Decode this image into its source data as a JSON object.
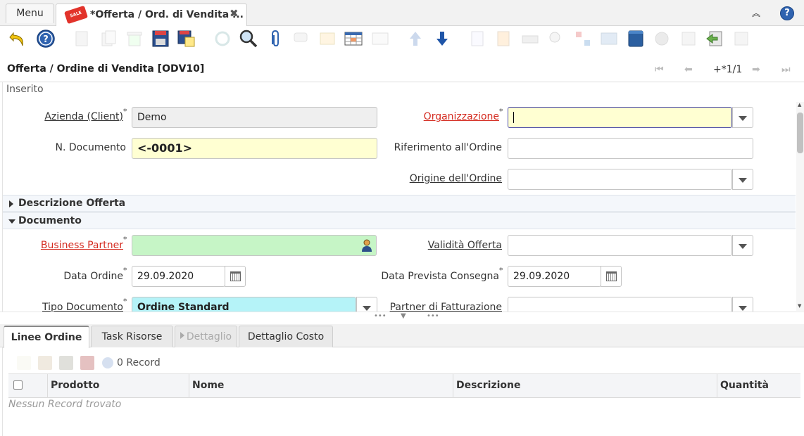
{
  "tabs": {
    "menu_label": "Menu",
    "doc_tab_title": "*Offerta / Ord. di Vendita ...",
    "doc_tab_icon_text": "SALE"
  },
  "window": {
    "title": "Offerta / Ordine di Vendita [ODV10]",
    "record_nav": "+*1/1",
    "status": "Inserito"
  },
  "form": {
    "client_label": "Azienda (Client)",
    "client_value": "Demo",
    "org_label": "Organizzazione",
    "org_value": "",
    "docno_label": "N. Documento",
    "docno_value": "<-0001>",
    "order_ref_label": "Riferimento all'Ordine",
    "order_ref_value": "",
    "order_source_label": "Origine dell'Ordine",
    "order_source_value": "",
    "section_description": "Descrizione Offerta",
    "section_document": "Documento",
    "bp_label": "Business Partner",
    "bp_value": "",
    "validity_label": "Validità Offerta",
    "validity_value": "",
    "date_ordered_label": "Data Ordine",
    "date_ordered_value": "29.09.2020",
    "date_promised_label": "Data Prevista Consegna",
    "date_promised_value": "29.09.2020",
    "doctype_label": "Tipo Documento",
    "doctype_value": "Ordine Standard",
    "bill_partner_label": "Partner di Fatturazione",
    "bill_partner_value": ""
  },
  "detail_tabs": [
    "Linee Ordine",
    "Task Risorse",
    "Dettaglio",
    "Dettaglio Costo"
  ],
  "grid": {
    "records": "0 Record",
    "columns": [
      "Prodotto",
      "Nome",
      "Descrizione",
      "Quantità"
    ],
    "empty_text": "Nessun Record trovato"
  },
  "colors": {
    "mandatory_label": "#d42a1f",
    "required_yellow": "#ffffd2",
    "bp_green": "#c6f5c6",
    "doctype_cyan": "#b5f3f8",
    "accent_blue": "#2f63b0"
  }
}
